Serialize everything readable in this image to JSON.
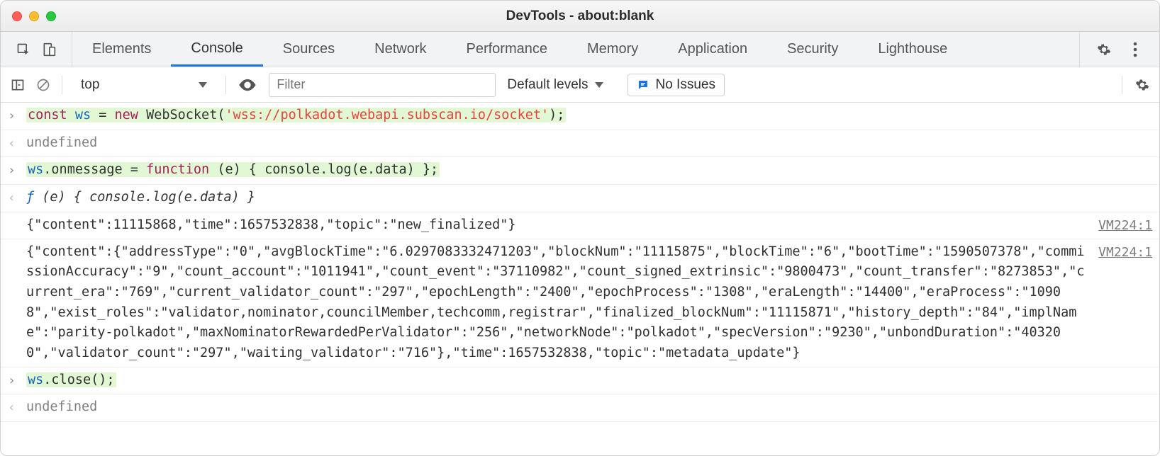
{
  "window": {
    "title": "DevTools - about:blank"
  },
  "tabs": {
    "items": [
      "Elements",
      "Console",
      "Sources",
      "Network",
      "Performance",
      "Memory",
      "Application",
      "Security",
      "Lighthouse"
    ],
    "active_index": 1
  },
  "toolbar": {
    "context": "top",
    "filter_placeholder": "Filter",
    "levels_label": "Default levels",
    "issues_label": "No Issues"
  },
  "console": {
    "entries": [
      {
        "kind": "input",
        "tokens": [
          {
            "t": "const ",
            "cls": "kw-const"
          },
          {
            "t": "ws",
            "cls": "var"
          },
          {
            "t": " = "
          },
          {
            "t": "new ",
            "cls": "kw-new"
          },
          {
            "t": "WebSocket",
            "cls": "cls"
          },
          {
            "t": "("
          },
          {
            "t": "'wss://polkadot.webapi.subscan.io/socket'",
            "cls": "str"
          },
          {
            "t": ");"
          }
        ]
      },
      {
        "kind": "output",
        "text": "undefined",
        "cls": "undef"
      },
      {
        "kind": "input",
        "tokens": [
          {
            "t": "ws",
            "cls": "var"
          },
          {
            "t": ".onmessage = "
          },
          {
            "t": "function",
            "cls": "func-kw"
          },
          {
            "t": " (e) { console.log(e.data) };"
          }
        ]
      },
      {
        "kind": "output-fn",
        "prefix": "ƒ ",
        "body": "(e) { console.log(e.data) }"
      },
      {
        "kind": "log",
        "text": "{\"content\":11115868,\"time\":1657532838,\"topic\":\"new_finalized\"}",
        "source": "VM224:1"
      },
      {
        "kind": "log",
        "text": "{\"content\":{\"addressType\":\"0\",\"avgBlockTime\":\"6.0297083332471203\",\"blockNum\":\"11115875\",\"blockTime\":\"6\",\"bootTime\":\"1590507378\",\"commissionAccuracy\":\"9\",\"count_account\":\"1011941\",\"count_event\":\"37110982\",\"count_signed_extrinsic\":\"9800473\",\"count_transfer\":\"8273853\",\"current_era\":\"769\",\"current_validator_count\":\"297\",\"epochLength\":\"2400\",\"epochProcess\":\"1308\",\"eraLength\":\"14400\",\"eraProcess\":\"10908\",\"exist_roles\":\"validator,nominator,councilMember,techcomm,registrar\",\"finalized_blockNum\":\"11115871\",\"history_depth\":\"84\",\"implName\":\"parity-polkadot\",\"maxNominatorRewardedPerValidator\":\"256\",\"networkNode\":\"polkadot\",\"specVersion\":\"9230\",\"unbondDuration\":\"403200\",\"validator_count\":\"297\",\"waiting_validator\":\"716\"},\"time\":1657532838,\"topic\":\"metadata_update\"}",
        "source": "VM224:1"
      },
      {
        "kind": "input",
        "tokens": [
          {
            "t": "ws",
            "cls": "var"
          },
          {
            "t": ".close();"
          }
        ]
      },
      {
        "kind": "output",
        "text": "undefined",
        "cls": "undef"
      }
    ]
  }
}
